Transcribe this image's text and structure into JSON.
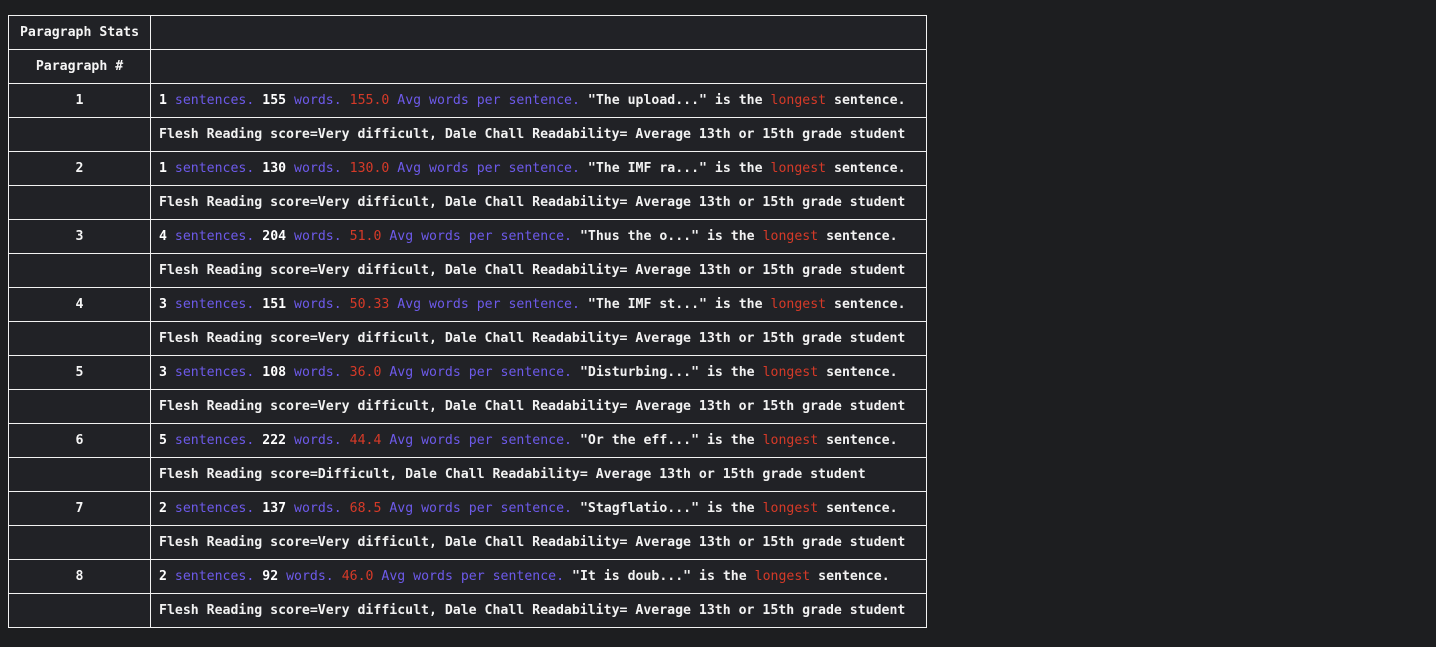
{
  "table": {
    "title": "Paragraph Stats",
    "column_header": "Paragraph #",
    "labels": {
      "sentences": "sentences.",
      "words": "words.",
      "avg": "Avg words per sentence.",
      "is_the": "is the",
      "longest": "longest",
      "sentence_end": "sentence.",
      "flesh_prefix": "Flesh Reading score=",
      "dale_prefix": ", Dale Chall Readability= "
    },
    "rows": [
      {
        "paragraph": "1",
        "sentences": "1",
        "words": "155",
        "avg_words": "155.0",
        "longest_snippet": "\"The upload...\"",
        "flesh_score": "Very difficult",
        "dale_chall": "Average 13th or 15th grade student"
      },
      {
        "paragraph": "2",
        "sentences": "1",
        "words": "130",
        "avg_words": "130.0",
        "longest_snippet": "\"The IMF ra...\"",
        "flesh_score": "Very difficult",
        "dale_chall": "Average 13th or 15th grade student"
      },
      {
        "paragraph": "3",
        "sentences": "4",
        "words": "204",
        "avg_words": "51.0",
        "longest_snippet": "\"Thus the o...\"",
        "flesh_score": "Very difficult",
        "dale_chall": "Average 13th or 15th grade student"
      },
      {
        "paragraph": "4",
        "sentences": "3",
        "words": "151",
        "avg_words": "50.33",
        "longest_snippet": "\"The IMF st...\"",
        "flesh_score": "Very difficult",
        "dale_chall": "Average 13th or 15th grade student"
      },
      {
        "paragraph": "5",
        "sentences": "3",
        "words": "108",
        "avg_words": "36.0",
        "longest_snippet": "\"Disturbing...\"",
        "flesh_score": "Very difficult",
        "dale_chall": "Average 13th or 15th grade student"
      },
      {
        "paragraph": "6",
        "sentences": "5",
        "words": "222",
        "avg_words": "44.4",
        "longest_snippet": "\"Or the eff...\"",
        "flesh_score": "Difficult",
        "dale_chall": "Average 13th or 15th grade student"
      },
      {
        "paragraph": "7",
        "sentences": "2",
        "words": "137",
        "avg_words": "68.5",
        "longest_snippet": "\"Stagflatio...\"",
        "flesh_score": "Very difficult",
        "dale_chall": "Average 13th or 15th grade student"
      },
      {
        "paragraph": "8",
        "sentences": "2",
        "words": "92",
        "avg_words": "46.0",
        "longest_snippet": "\"It is doub...\"",
        "flesh_score": "Very difficult",
        "dale_chall": "Average 13th or 15th grade student"
      }
    ]
  },
  "colors": {
    "background": "#1d1e20",
    "cell_background": "#212226",
    "border": "#f2f2f2",
    "title": "#22d3e0",
    "keyword": "#6d5aea",
    "highlight": "#d63a28",
    "text": "#f5f5f5"
  }
}
